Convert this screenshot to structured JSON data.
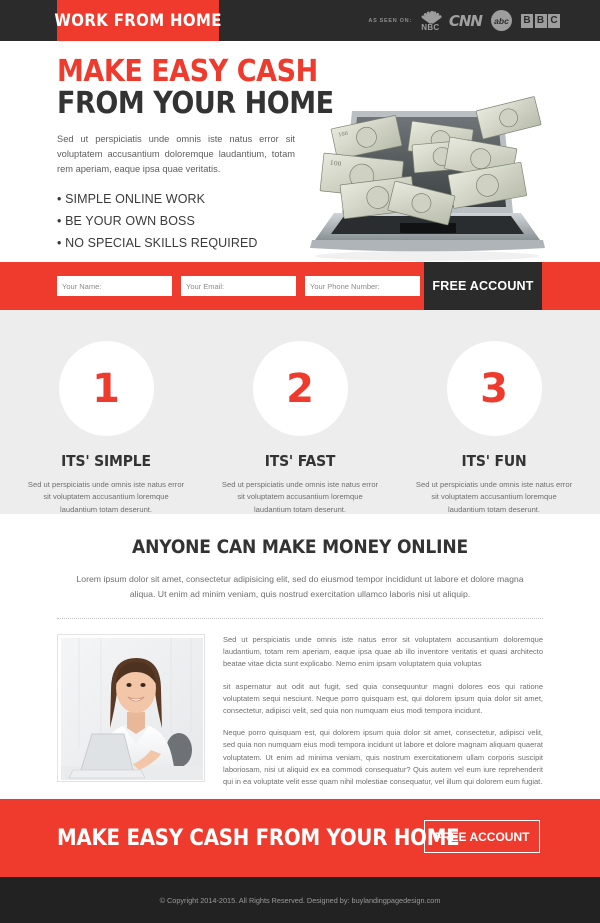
{
  "header": {
    "logo": "WORK FROM HOME",
    "as_seen_on_label": "AS SEEN ON:",
    "brands": [
      "NBC",
      "CNN",
      "abc",
      "BBC"
    ],
    "bg_color": "#2b2b2b",
    "accent_color": "#ef3b2d"
  },
  "hero": {
    "headline_line1": "MAKE EASY CASH",
    "headline_line2": "FROM YOUR HOME",
    "subtext": "Sed ut perspiciatis unde omnis iste natus error sit voluptatem accusantium doloremque laudantium, totam rem aperiam, eaque ipsa quae veritatis.",
    "bullets": [
      "SIMPLE ONLINE WORK",
      "BE YOUR OWN BOSS",
      "NO SPECIAL SKILLS REQUIRED"
    ],
    "image_alt": "laptop-with-money-flying-out"
  },
  "form": {
    "name_placeholder": "Your Name:",
    "email_placeholder": "Your Email:",
    "phone_placeholder": "Your Phone Number:",
    "submit_label": "FREE ACCOUNT",
    "band_color": "#ef3b2d",
    "button_color": "#2b2b2b"
  },
  "features": {
    "items": [
      {
        "number": "1",
        "title": "ITS' SIMPLE",
        "desc": "Sed ut perspiciatis unde omnis iste natus error sit voluptatem accusantium loremque laudantium totam deserunt."
      },
      {
        "number": "2",
        "title": "ITS' FAST",
        "desc": "Sed ut perspiciatis unde omnis iste natus error sit voluptatem accusantium loremque laudantium totam deserunt."
      },
      {
        "number": "3",
        "title": "ITS' FUN",
        "desc": "Sed ut perspiciatis unde omnis iste natus error sit voluptatem accusantium loremque laudantium totam deserunt."
      }
    ],
    "bg_color": "#ededed"
  },
  "content": {
    "title": "ANYONE CAN MAKE MONEY ONLINE",
    "intro": "Lorem ipsum dolor sit amet, consectetur adipisicing elit, sed do eiusmod tempor incididunt ut labore et dolore magna aliqua. Ut enim ad minim veniam, quis nostrud exercitation ullamco laboris nisi ut aliquip.",
    "photo_alt": "smiling-businesswoman-at-laptop",
    "paragraphs": [
      "Sed ut perspiciatis unde omnis iste natus error sit voluptatem accusantium doloremque laudantium, totam rem aperiam, eaque ipsa quae ab illo inventore veritatis et quasi architecto beatae vitae dicta sunt explicabo. Nemo enim ipsam voluptatem quia voluptas",
      " sit aspernatur aut odit aut fugit, sed quia consequuntur magni dolores eos qui ratione voluptatem sequi nesciunt. Neque porro quisquam est, qui dolorem ipsum quia dolor sit amet, consectetur, adipisci velit, sed quia non numquam eius modi tempora incidunt.",
      "Neque porro quisquam est, qui dolorem ipsum quia dolor sit amet, consectetur, adipisci velit, sed quia non numquam eius modi tempora incidunt ut labore et dolore magnam aliquam quaerat voluptatem. Ut enim ad minima veniam, quis nostrum exercitationem ullam corporis suscipit laboriosam, nisi ut aliquid ex ea commodi consequatur? Quis autem vel eum iure reprehenderit qui in ea voluptate velit esse quam nihil molestiae consequatur, vel illum qui dolorem eum fugiat."
    ]
  },
  "cta": {
    "text": "MAKE EASY CASH FROM YOUR HOME",
    "button_label": "FREE ACCOUNT",
    "bg_color": "#ef3b2d"
  },
  "footer": {
    "copyright": "© Copyright 2014-2015. All Rights Reserved. Designed by: buylandingpagedesign.com",
    "bg_color": "#222222"
  }
}
